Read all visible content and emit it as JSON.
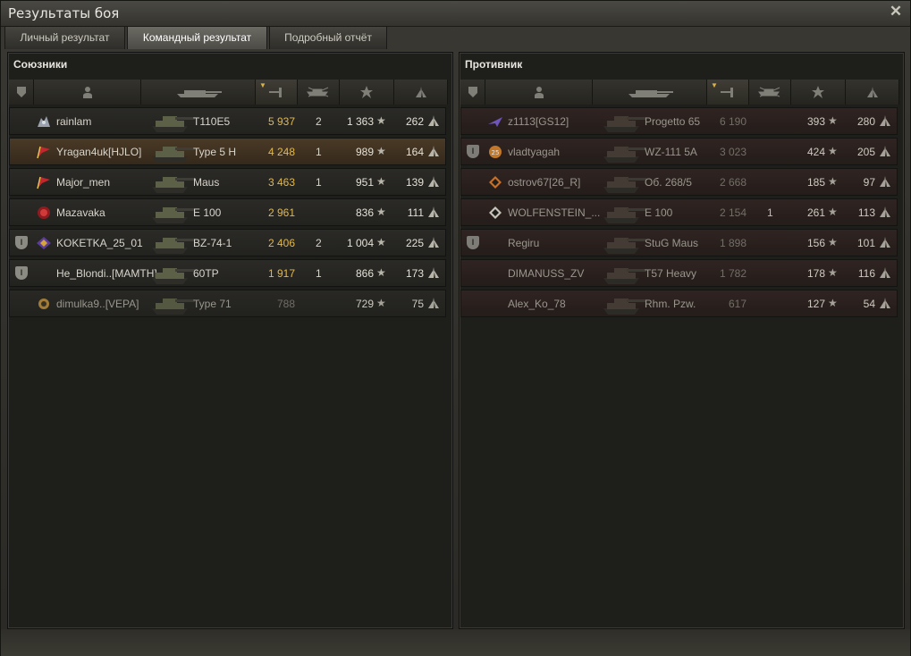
{
  "window": {
    "title": "Результаты боя"
  },
  "tabs": [
    {
      "label": "Личный результат",
      "active": false
    },
    {
      "label": "Командный результат",
      "active": true
    },
    {
      "label": "Подробный отчёт",
      "active": false
    }
  ],
  "allies": {
    "title": "Союзники",
    "rows": [
      {
        "platoon": "",
        "badge": "wolf",
        "player": "rainlam",
        "tank": "T110E5",
        "damage": "5 937",
        "frags": "2",
        "xp": "1 363",
        "hp": "262",
        "self": false,
        "dead": false
      },
      {
        "platoon": "",
        "badge": "red-flag",
        "player": "Yragan4uk[HJLO]",
        "tank": "Type 5 H",
        "damage": "4 248",
        "frags": "1",
        "xp": "989",
        "hp": "164",
        "self": true,
        "dead": false
      },
      {
        "platoon": "",
        "badge": "red-flag",
        "player": "Major_men",
        "tank": "Maus",
        "damage": "3 463",
        "frags": "1",
        "xp": "951",
        "hp": "139",
        "self": false,
        "dead": false
      },
      {
        "platoon": "",
        "badge": "red-circle",
        "player": "Mazavaka",
        "tank": "E 100",
        "damage": "2 961",
        "frags": "",
        "xp": "836",
        "hp": "111",
        "self": false,
        "dead": false
      },
      {
        "platoon": "I",
        "badge": "purple-diamond",
        "player": "KOKETKA_25_01",
        "tank": "BZ-74-1",
        "damage": "2 406",
        "frags": "2",
        "xp": "1 004",
        "hp": "225",
        "self": false,
        "dead": false
      },
      {
        "platoon": "I",
        "badge": "",
        "player": "He_Blondi..[MAMTH]",
        "tank": "60TP",
        "damage": "1 917",
        "frags": "1",
        "xp": "866",
        "hp": "173",
        "self": false,
        "dead": false
      },
      {
        "platoon": "",
        "badge": "gear",
        "player": "dimulka9..[VEPA]",
        "tank": "Type 71",
        "damage": "788",
        "frags": "",
        "xp": "729",
        "hp": "75",
        "self": false,
        "dead": true
      }
    ]
  },
  "enemies": {
    "title": "Противник",
    "rows": [
      {
        "platoon": "",
        "badge": "purple-plane",
        "player": "z1113[GS12]",
        "tank": "Progetto 65",
        "damage": "6 190",
        "frags": "",
        "xp": "393",
        "hp": "280",
        "self": false,
        "dead": true
      },
      {
        "platoon": "I",
        "badge": "orange-25",
        "player": "vladtyagah",
        "tank": "WZ-111 5A",
        "damage": "3 023",
        "frags": "",
        "xp": "424",
        "hp": "205",
        "self": false,
        "dead": true
      },
      {
        "platoon": "",
        "badge": "diamond-orange",
        "player": "ostrov67[26_R]",
        "tank": "Об. 268/5",
        "damage": "2 668",
        "frags": "",
        "xp": "185",
        "hp": "97",
        "self": false,
        "dead": true
      },
      {
        "platoon": "",
        "badge": "diamond-white",
        "player": "WOLFENSTEIN_...",
        "tank": "E 100",
        "damage": "2 154",
        "frags": "1",
        "xp": "261",
        "hp": "113",
        "self": false,
        "dead": true
      },
      {
        "platoon": "I",
        "badge": "",
        "player": "Regiru",
        "tank": "StuG Maus",
        "damage": "1 898",
        "frags": "",
        "xp": "156",
        "hp": "101",
        "self": false,
        "dead": true
      },
      {
        "platoon": "",
        "badge": "",
        "player": "DIMANUSS_ZV",
        "tank": "T57 Heavy",
        "damage": "1 782",
        "frags": "",
        "xp": "178",
        "hp": "116",
        "self": false,
        "dead": true
      },
      {
        "platoon": "",
        "badge": "",
        "player": "Alex_Ko_78",
        "tank": "Rhm. Pzw.",
        "damage": "617",
        "frags": "",
        "xp": "127",
        "hp": "54",
        "self": false,
        "dead": true
      }
    ]
  }
}
